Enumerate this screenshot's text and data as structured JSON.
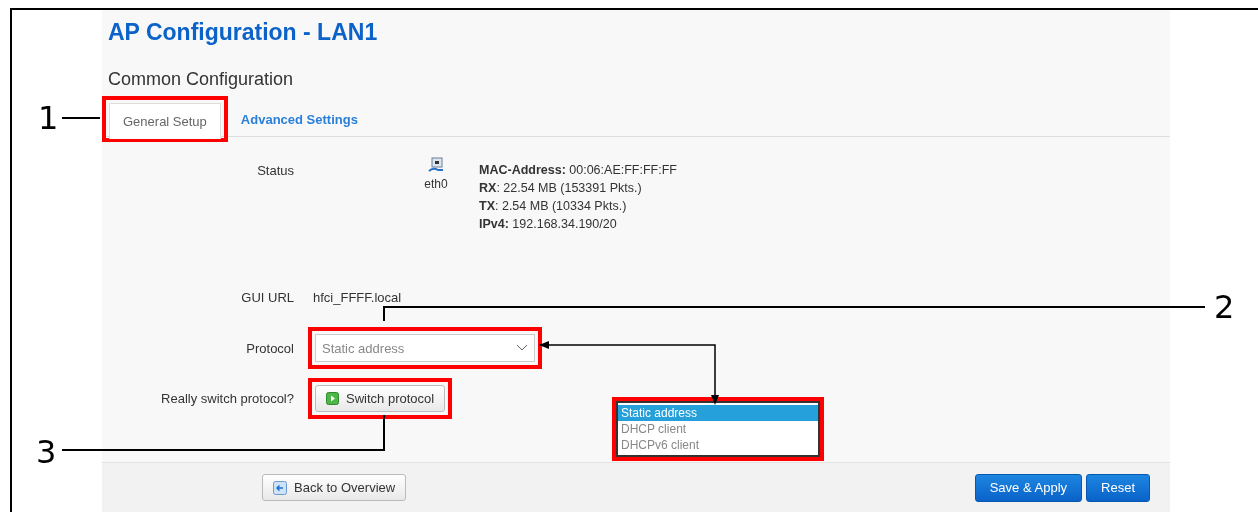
{
  "title": "AP Configuration - LAN1",
  "section": "Common Configuration",
  "tabs": [
    {
      "label": "General Setup",
      "selected": true
    },
    {
      "label": "Advanced Settings",
      "selected": false
    }
  ],
  "status": {
    "label": "Status",
    "device": "eth0",
    "lines": [
      "**MAC-Address:** 00:06:AE:FF:FF:FF",
      "**RX**: 22.54 MB (153391 Pkts.)",
      "**TX**: 2.54 MB (10334 Pkts.)",
      "**IPv4:** 192.168.34.190/20"
    ]
  },
  "gui_url": {
    "label": "GUI URL",
    "value": "hfci_FFFF.local"
  },
  "protocol": {
    "label": "Protocol",
    "value": "Static address",
    "options": [
      {
        "label": "Static address",
        "selected": true
      },
      {
        "label": "DHCP client",
        "selected": false
      },
      {
        "label": "DHCPv6 client",
        "selected": false
      }
    ]
  },
  "switch": {
    "label": "Really switch protocol?",
    "button": "Switch protocol"
  },
  "footer": {
    "back": "Back to Overview",
    "save": "Save & Apply",
    "reset": "Reset"
  },
  "callouts": [
    "1",
    "2",
    "3"
  ]
}
